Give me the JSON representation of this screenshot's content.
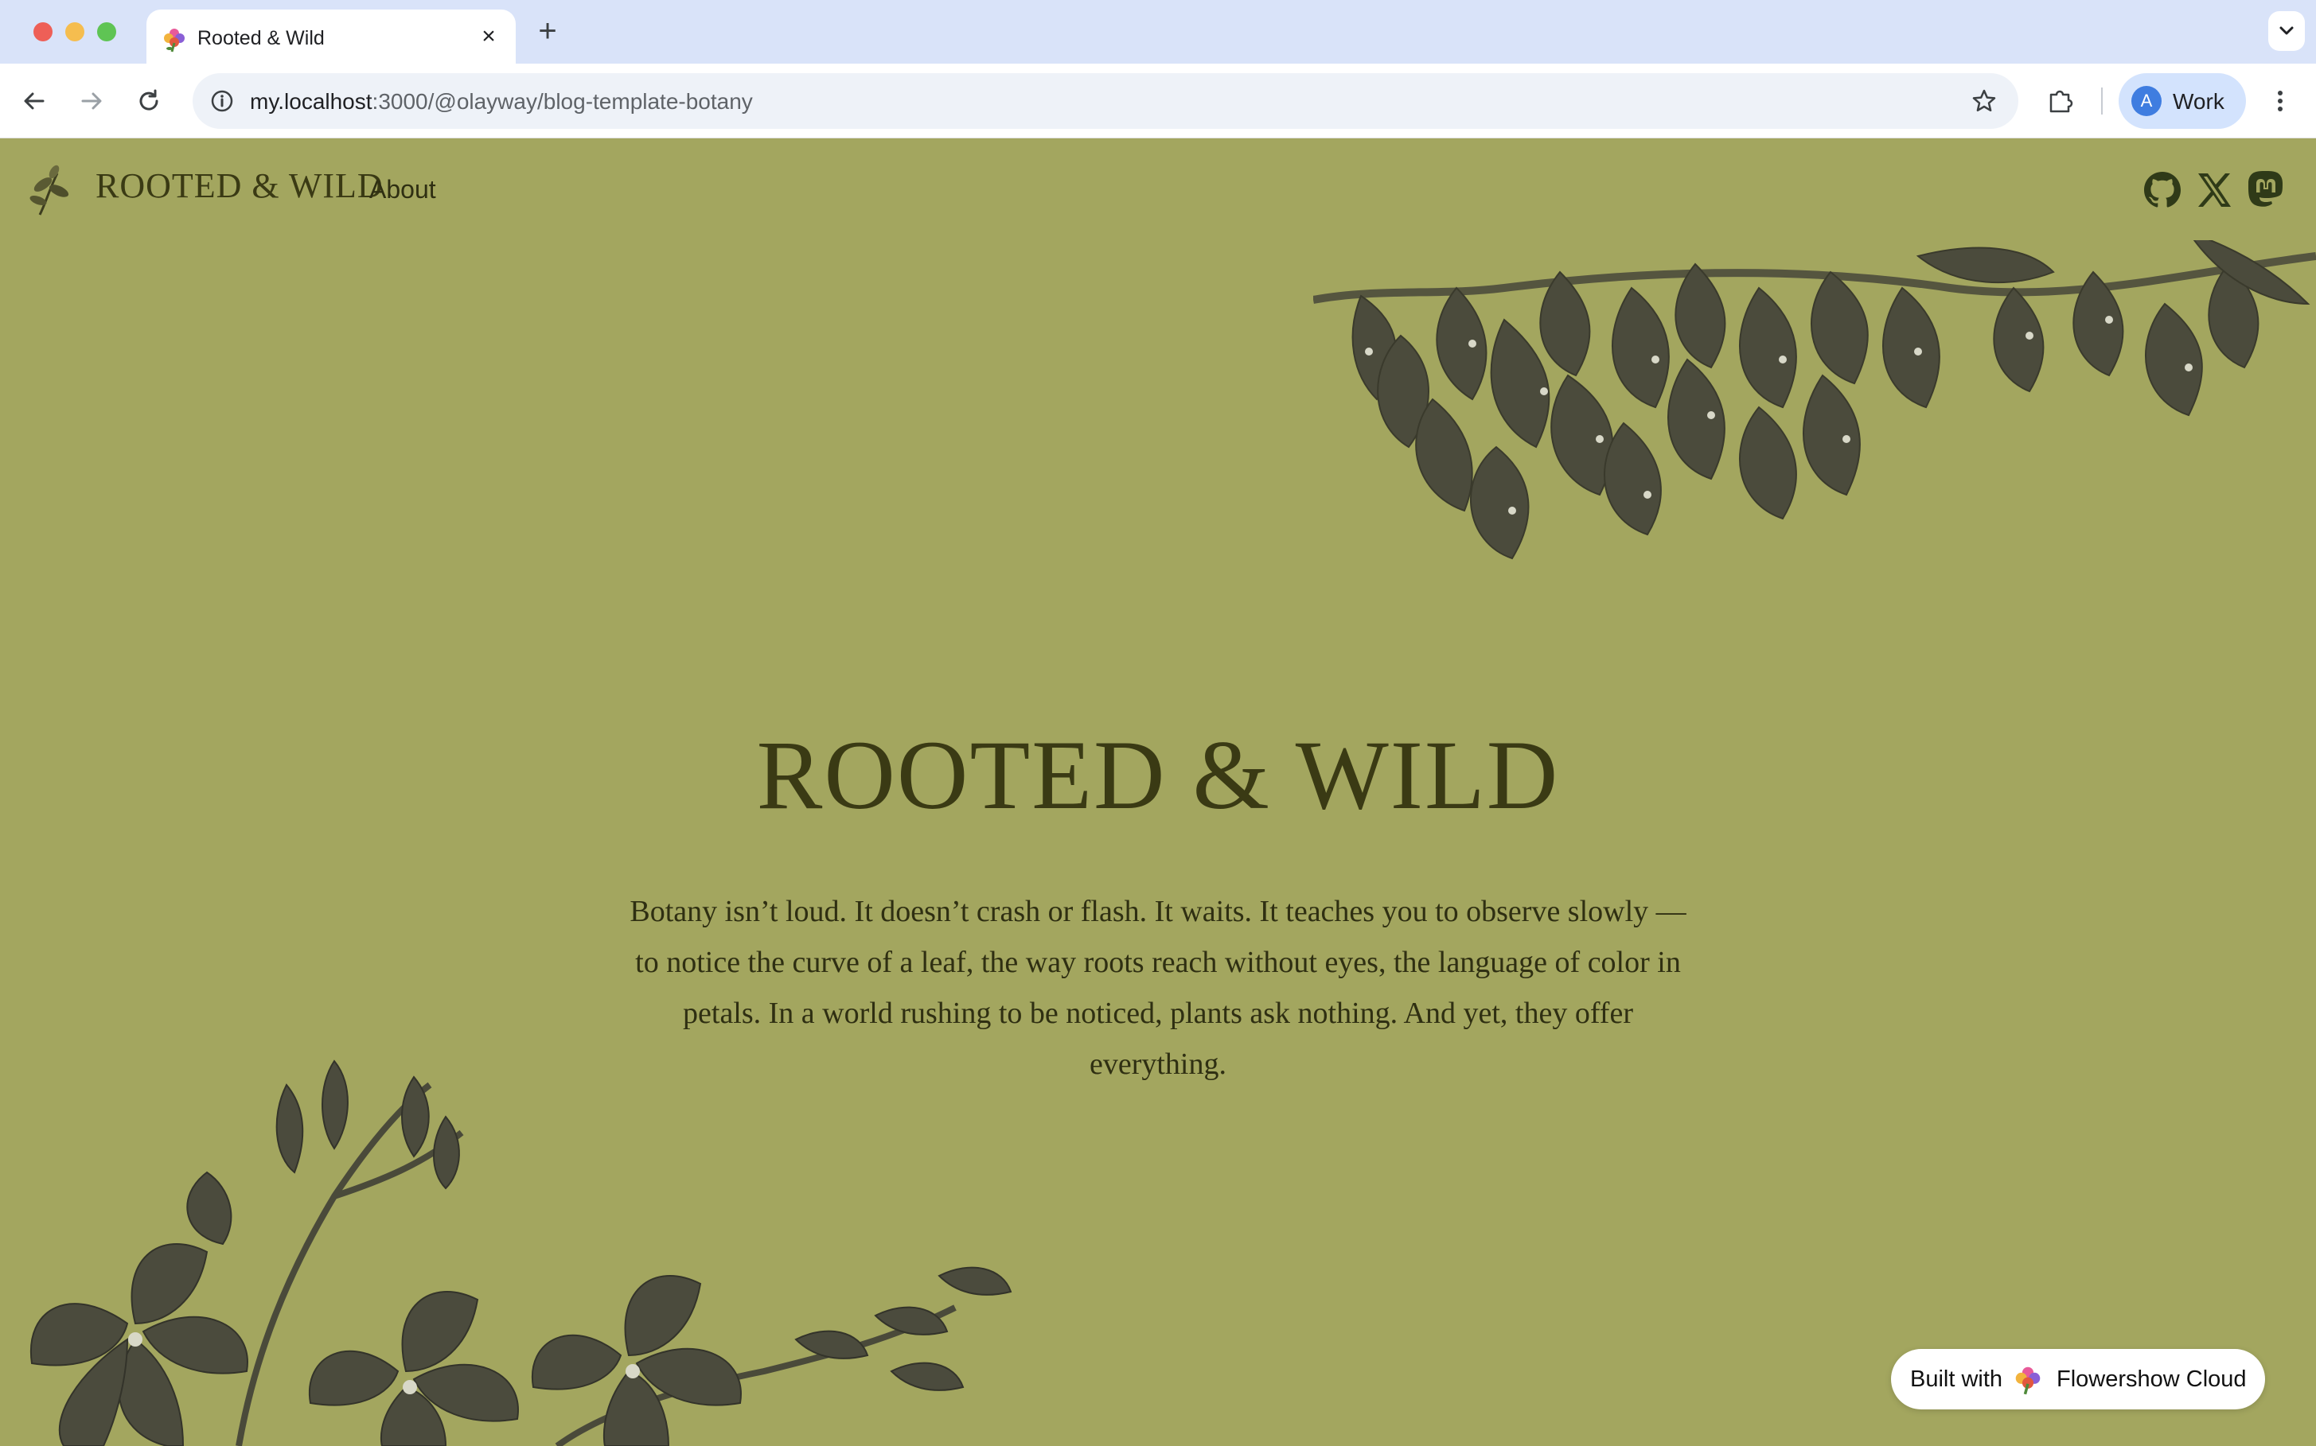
{
  "browser": {
    "tab": {
      "title": "Rooted & Wild",
      "favicon": "flower-icon",
      "close": "×"
    },
    "new_tab": "+",
    "address": {
      "host": "my.localhost",
      "path": ":3000/@olayway/blog-template-botany"
    },
    "profile": {
      "initial": "A",
      "label": "Work"
    }
  },
  "site": {
    "name": "ROOTED & WILD",
    "nav": {
      "about": "About"
    },
    "social": [
      "github-icon",
      "x-icon",
      "mastodon-icon"
    ]
  },
  "hero": {
    "title": "ROOTED & WILD",
    "text": "Botany isn’t loud. It doesn’t crash or flash. It waits. It teaches you to observe slowly — to notice the curve of a leaf, the way roots reach without eyes, the language of color in petals. In a world rushing to be noticed, plants ask nothing. And yet, they offer everything."
  },
  "badge": {
    "prefix": "Built with",
    "brand": "Flowershow Cloud"
  },
  "colors": {
    "page_bg": "#a3a65f",
    "text_dark": "#3a3a14",
    "foliage": "#4a4a3a",
    "tab_bar": "#d9e3f9"
  }
}
